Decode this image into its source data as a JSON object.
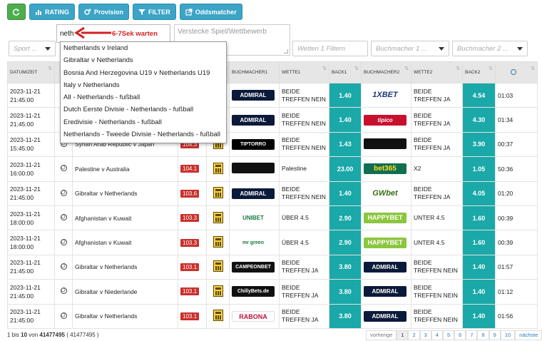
{
  "toolbar": {
    "refresh_icon": "refresh-icon",
    "rating": "RATING",
    "provision": "Provision",
    "filter": "FILTER",
    "oddsmatcher": "Oddsmatcher"
  },
  "search": {
    "value": "neth"
  },
  "annotation": "6-7Sek warten",
  "hide_box": {
    "placeholder": "Verstecke Spiel/Wettbewerb"
  },
  "filters": {
    "sport": "Sport ...",
    "wette": "Wetten 1 Filtern",
    "buch1": "Buchmacher 1 ...",
    "buch2": "Buchmacher 2 ..."
  },
  "dropdown": [
    "Netherlands v Ireland",
    "Gibraltar v Netherlands",
    "Bosnia And Herzegovina U19 v Netherlands U19",
    "Italy v Netherlands",
    "All - Netherlands - fußball",
    "Dutch Eerste Divisie - Netherlands - fußball",
    "Eredivisie - Netherlands - fußball",
    "Netherlands - Tweede Divisie - Netherlands - fußball"
  ],
  "table": {
    "headers": [
      "DATUM/ZEIT",
      "",
      "",
      "",
      "",
      "BUCHMACHER1",
      "WETTE1",
      "BACK1",
      "BUCHMACHER2",
      "WETTE2",
      "BACK2",
      ""
    ],
    "rows": [
      {
        "date": "2023-11-21",
        "time": "21:45:00",
        "event": "",
        "score": "",
        "bm1": "ADMIRAL",
        "w1a": "BEIDE",
        "w1b": "TREFFEN NEIN",
        "b1": "1.40",
        "bm2": "1XBET",
        "w2a": "BEIDE",
        "w2b": "TREFFEN JA",
        "b2": "4.54",
        "t": "01:03"
      },
      {
        "date": "2023-11-21",
        "time": "21:45:00",
        "event": "",
        "score": "",
        "bm1": "ADMIRAL",
        "w1a": "BEIDE",
        "w1b": "TREFFEN NEIN",
        "b1": "1.40",
        "bm2": "tipico",
        "w2a": "BEIDE",
        "w2b": "TREFFEN JA",
        "b2": "4.30",
        "t": "01:34"
      },
      {
        "date": "2023-11-21",
        "time": "15:45:00",
        "event": "Syrian Arab Republic v Japan",
        "score": "104.3",
        "bm1": "TIPTORRO",
        "w1a": "BEIDE",
        "w1b": "TREFFEN NEIN",
        "b1": "1.43",
        "bm2": "",
        "w2a": "BEIDE",
        "w2b": "TREFFEN JA",
        "b2": "3.90",
        "t": "00:37"
      },
      {
        "date": "2023-11-21",
        "time": "16:00:00",
        "event": "Palestine v Australia",
        "score": "104.1",
        "bm1": "",
        "w1a": "Palestine",
        "w1b": "",
        "b1": "23.00",
        "bm2": "bet365",
        "w2a": "X2",
        "w2b": "",
        "b2": "1.05",
        "t": "50:36"
      },
      {
        "date": "2023-11-21",
        "time": "21:45:00",
        "event": "Gibraltar v Netherlands",
        "score": "103.6",
        "bm1": "ADMIRAL",
        "w1a": "BEIDE",
        "w1b": "TREFFEN NEIN",
        "b1": "1.40",
        "bm2": "GWbet",
        "w2a": "BEIDE",
        "w2b": "TREFFEN JA",
        "b2": "4.05",
        "t": "01:20"
      },
      {
        "date": "2023-11-21",
        "time": "18:00:00",
        "event": "Afghanistan v Kuwait",
        "score": "103.3",
        "bm1": "UNIBET",
        "w1a": "ÜBER 4.5",
        "w1b": "",
        "b1": "2.90",
        "bm2": "HAPPYBET",
        "w2a": "UNTER 4.5",
        "w2b": "",
        "b2": "1.60",
        "t": "00:39"
      },
      {
        "date": "2023-11-21",
        "time": "18:00:00",
        "event": "Afghanistan v Kuwait",
        "score": "103.3",
        "bm1": "mr green",
        "w1a": "ÜBER 4.5",
        "w1b": "",
        "b1": "2.90",
        "bm2": "HAPPYBET",
        "w2a": "UNTER 4.5",
        "w2b": "",
        "b2": "1.60",
        "t": "00:39"
      },
      {
        "date": "2023-11-21",
        "time": "21:45:00",
        "event": "Gibraltar v Netherlands",
        "score": "103.1",
        "bm1": "CAMPEONBET",
        "w1a": "BEIDE",
        "w1b": "TREFFEN JA",
        "b1": "3.80",
        "bm2": "ADMIRAL",
        "w2a": "BEIDE",
        "w2b": "TREFFEN NEIN",
        "b2": "1.40",
        "t": "01:57"
      },
      {
        "date": "2023-11-21",
        "time": "21:45:00",
        "event": "Gibraltar v Niederlande",
        "score": "103.1",
        "bm1": "ChillyBets.de",
        "w1a": "BEIDE",
        "w1b": "TREFFEN JA",
        "b1": "3.80",
        "bm2": "ADMIRAL",
        "w2a": "BEIDE",
        "w2b": "TREFFEN NEIN",
        "b2": "1.40",
        "t": "01:12"
      },
      {
        "date": "2023-11-21",
        "time": "21:45:00",
        "event": "Gibraltar v Netherlands",
        "score": "103.1",
        "bm1": "RABONA",
        "w1a": "BEIDE",
        "w1b": "TREFFEN JA",
        "b1": "3.80",
        "bm2": "ADMIRAL",
        "w2a": "BEIDE",
        "w2b": "TREFFEN NEIN",
        "b2": "1.40",
        "t": "01:56"
      }
    ]
  },
  "footer": {
    "pre": "1 bis ",
    "shown": "10",
    "mid": " von ",
    "total": "41477495",
    "post": " ( 41477495 )"
  },
  "pager": [
    "vorherige",
    "1",
    "2",
    "3",
    "4",
    "5",
    "6",
    "7",
    "8",
    "9",
    "10",
    "nächste"
  ],
  "colors": {
    "accent": "#3ca4c6",
    "odds": "#1ba8a8",
    "score": "#c9302c"
  }
}
